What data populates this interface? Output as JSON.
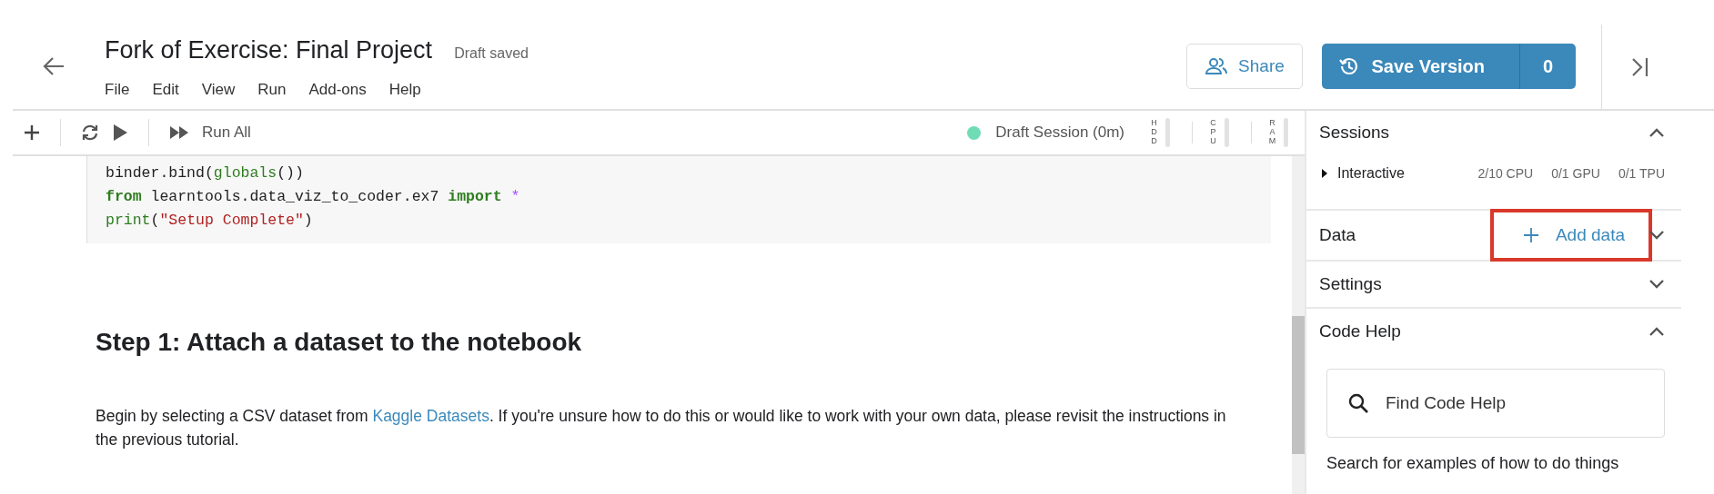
{
  "header": {
    "title": "Fork of Exercise: Final Project",
    "status": "Draft saved",
    "menu": [
      "File",
      "Edit",
      "View",
      "Run",
      "Add-ons",
      "Help"
    ],
    "share": "Share",
    "save_version": "Save Version",
    "version_count": "0"
  },
  "toolbar": {
    "run_all": "Run All",
    "session": "Draft Session (0m)",
    "meters": [
      {
        "label": "HDD"
      },
      {
        "label": "CPU"
      },
      {
        "label": "RAM"
      }
    ]
  },
  "code_cell": {
    "lines": [
      [
        {
          "kind": "plain",
          "text": "binder.bind("
        },
        {
          "kind": "builtin",
          "text": "globals"
        },
        {
          "kind": "plain",
          "text": "())"
        }
      ],
      [
        {
          "kind": "keyword",
          "text": "from"
        },
        {
          "kind": "plain",
          "text": " learntools.data_viz_to_coder.ex7 "
        },
        {
          "kind": "keyword",
          "text": "import"
        },
        {
          "kind": "operator",
          "text": " *"
        }
      ],
      [
        {
          "kind": "builtin",
          "text": "print"
        },
        {
          "kind": "plain",
          "text": "("
        },
        {
          "kind": "string",
          "text": "\"Setup Complete\""
        },
        {
          "kind": "plain",
          "text": ")"
        }
      ]
    ]
  },
  "markdown": {
    "heading": "Step 1: Attach a dataset to the notebook",
    "paragraph": {
      "before": "Begin by selecting a CSV dataset from ",
      "link": "Kaggle Datasets",
      "after": ". If you're unsure how to do this or would like to work with your own data, please revisit the instructions in the previous tutorial."
    }
  },
  "sidebar": [
    {
      "kind": "sessions",
      "title": "Sessions",
      "expanded": true,
      "session": {
        "label": "Interactive",
        "expanded": false,
        "stats": [
          "2/10 CPU",
          "0/1 GPU",
          "0/1 TPU"
        ]
      }
    },
    {
      "kind": "data",
      "title": "Data",
      "expanded": false,
      "action": "Add data",
      "highlighted": true
    },
    {
      "kind": "settings",
      "title": "Settings",
      "expanded": false
    },
    {
      "kind": "code_help",
      "title": "Code Help",
      "expanded": true,
      "search": {
        "placeholder": "Find Code Help"
      },
      "hint": "Search for examples of how to do things"
    }
  ]
}
